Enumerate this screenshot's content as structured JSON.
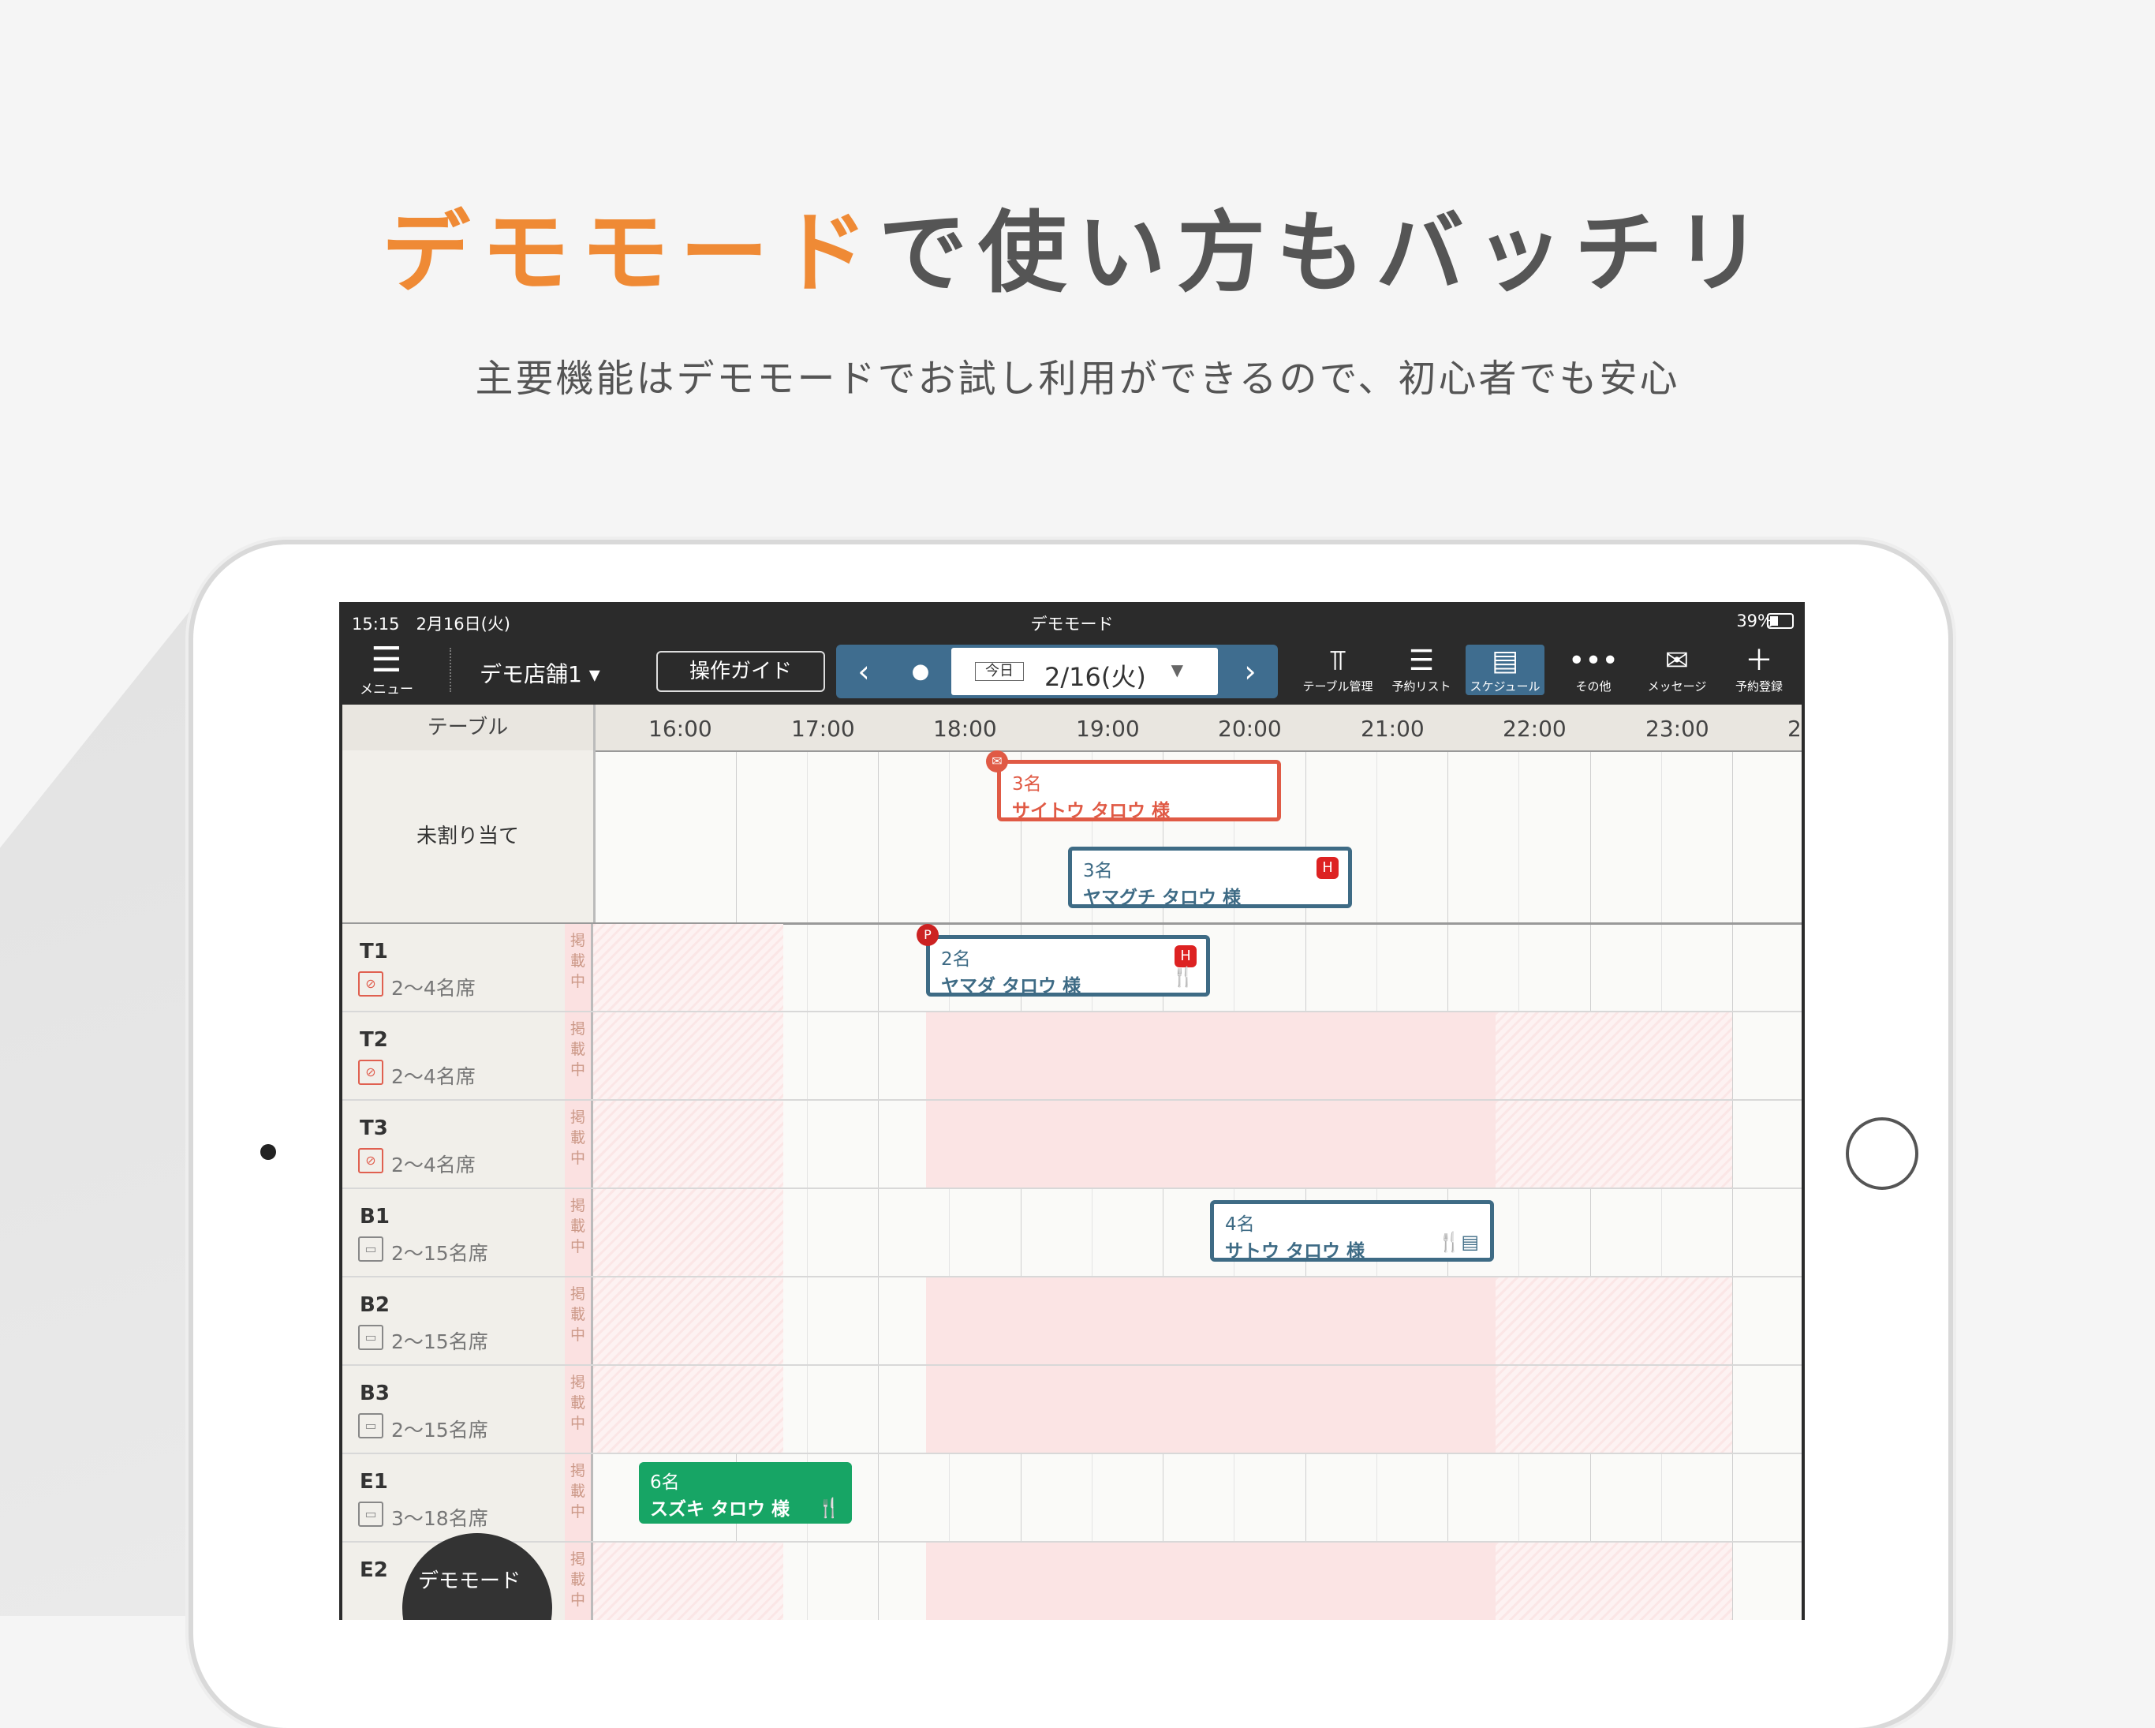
{
  "headline": {
    "accent": "デモモード",
    "rest": "で使い方もバッチリ"
  },
  "subheadline": "主要機能はデモモードでお試し利用ができるので、初心者でも安心",
  "status_bar": {
    "time": "15:15　2月16日(火)",
    "center": "デモモード",
    "battery": "39%"
  },
  "toolbar": {
    "menu_label": "メニュー",
    "store": "デモ店舗1 ▾",
    "guide_label": "操作ガイド",
    "today_label": "今日",
    "date": "2/16(火)",
    "tools": [
      {
        "label": "テーブル管理",
        "icon": "table-icon",
        "active": false
      },
      {
        "label": "予約リスト",
        "icon": "list-icon",
        "active": false
      },
      {
        "label": "スケジュール",
        "icon": "schedule-icon",
        "active": true
      },
      {
        "label": "その他",
        "icon": "more-icon",
        "active": false
      },
      {
        "label": "メッセージ",
        "icon": "mail-icon",
        "active": false
      },
      {
        "label": "予約登録",
        "icon": "plus-icon",
        "active": false
      }
    ]
  },
  "schedule": {
    "table_header": "テーブル",
    "hours": [
      "16:00",
      "17:00",
      "18:00",
      "19:00",
      "20:00",
      "21:00",
      "22:00",
      "23:00",
      "2"
    ],
    "unassigned_label": "未割り当て",
    "keisai": "掲載中",
    "rows": [
      {
        "id": "T1",
        "seats": "2〜4名席",
        "nosmoke": true
      },
      {
        "id": "T2",
        "seats": "2〜4名席",
        "nosmoke": true
      },
      {
        "id": "T3",
        "seats": "2〜4名席",
        "nosmoke": true
      },
      {
        "id": "B1",
        "seats": "2〜15名席",
        "nosmoke": false
      },
      {
        "id": "B2",
        "seats": "2〜15名席",
        "nosmoke": false
      },
      {
        "id": "B3",
        "seats": "2〜15名席",
        "nosmoke": false
      },
      {
        "id": "E1",
        "seats": "3〜18名席",
        "nosmoke": false
      },
      {
        "id": "E2",
        "seats": "",
        "nosmoke": false
      }
    ],
    "reservations": [
      {
        "count": "3名",
        "name": "サイトウ タロウ 様"
      },
      {
        "count": "3名",
        "name": "ヤマグチ タロウ 様"
      },
      {
        "count": "2名",
        "name": "ヤマダ タロウ 様"
      },
      {
        "count": "4名",
        "name": "サトウ タロウ 様"
      },
      {
        "count": "6名",
        "name": "スズキ タロウ 様"
      }
    ]
  },
  "demo_button": "デモモード"
}
